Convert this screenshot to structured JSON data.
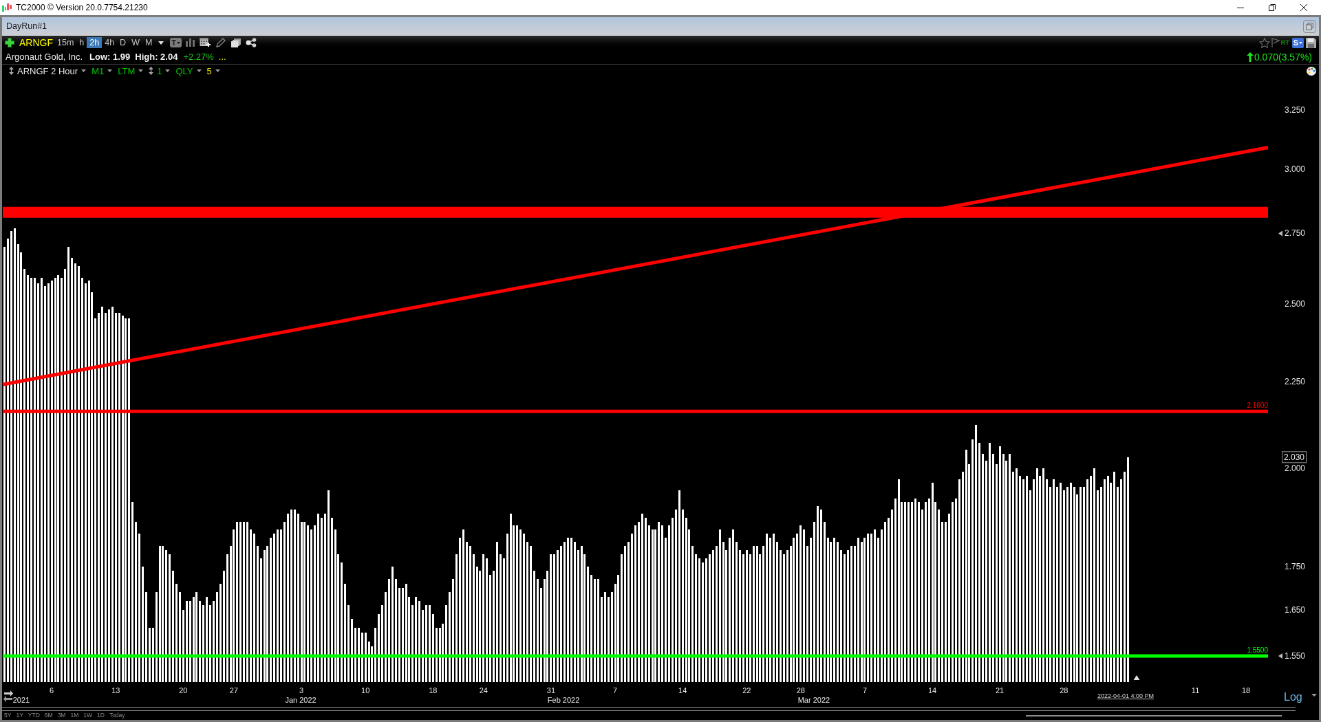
{
  "window": {
    "title": "TC2000 © Version 20.0.7754.21230"
  },
  "layout_tab": {
    "title": "DayRun#1"
  },
  "toolbar": {
    "symbol": "ARNGF",
    "intervals": [
      {
        "label": "15m",
        "selected": false
      },
      {
        "label": "h",
        "selected": false
      },
      {
        "label": "2h",
        "selected": true
      },
      {
        "label": "4h",
        "selected": false
      },
      {
        "label": "D",
        "selected": false
      },
      {
        "label": "W",
        "selected": false
      },
      {
        "label": "M",
        "selected": false
      }
    ],
    "text_button": "T",
    "rt_label": "RT",
    "s_button": "S"
  },
  "quote": {
    "company": "Argonaut Gold, Inc.",
    "low": "Low: 1.99",
    "high": "High: 2.04",
    "change_percent": "+2.27%",
    "more": "...",
    "net_change": "0.070(3.57%)"
  },
  "chart_settings": [
    {
      "kind": "stepper",
      "text": "ARNGF 2 Hour",
      "color": "#e8e8e8"
    },
    {
      "kind": "dropdown",
      "text": "M1",
      "color": "#00c800"
    },
    {
      "kind": "dropdown",
      "text": "LTM",
      "color": "#00c800"
    },
    {
      "kind": "stepper",
      "text": "1",
      "color": "#00c800"
    },
    {
      "kind": "dropdown",
      "text": "QLY",
      "color": "#00c800"
    },
    {
      "kind": "dropdown",
      "text": "5",
      "color": "#e6e600"
    }
  ],
  "chart": {
    "chart_data": {
      "type": "bar",
      "log": true,
      "categories": [
        null,
        null,
        null,
        null,
        null,
        null,
        null,
        null,
        null,
        null,
        null,
        null,
        null,
        null,
        "6",
        null,
        null,
        null,
        null,
        null,
        null,
        null,
        null,
        null,
        null,
        null,
        null,
        null,
        null,
        null,
        null,
        null,
        null,
        "13",
        null,
        null,
        null,
        null,
        null,
        null,
        null,
        null,
        null,
        null,
        null,
        null,
        null,
        null,
        null,
        null,
        null,
        null,
        null,
        "20",
        null,
        null,
        null,
        null,
        null,
        null,
        null,
        null,
        null,
        null,
        null,
        null,
        null,
        null,
        "27",
        null,
        null,
        null,
        null,
        null,
        null,
        null,
        null,
        null,
        null,
        null,
        null,
        null,
        null,
        null,
        null,
        null,
        null,
        null,
        "3",
        null,
        null,
        null,
        null,
        null,
        null,
        null,
        null,
        null,
        null,
        null,
        null,
        null,
        null,
        null,
        null,
        null,
        null,
        "10",
        null,
        null,
        null,
        null,
        null,
        null,
        null,
        null,
        null,
        null,
        null,
        null,
        null,
        null,
        null,
        null,
        null,
        null,
        null,
        "18",
        null,
        null,
        null,
        null,
        null,
        null,
        null,
        null,
        null,
        null,
        null,
        null,
        null,
        null,
        "24",
        null,
        null,
        null,
        null,
        null,
        null,
        null,
        null,
        null,
        null,
        null,
        null,
        null,
        null,
        null,
        null,
        null,
        null,
        null,
        "31",
        null,
        null,
        null,
        null,
        null,
        null,
        null,
        null,
        null,
        null,
        null,
        null,
        null,
        null,
        null,
        null,
        null,
        null,
        "7",
        null,
        null,
        null,
        null,
        null,
        null,
        null,
        null,
        null,
        null,
        null,
        null,
        null,
        null,
        null,
        null,
        null,
        null,
        null,
        "14",
        null,
        null,
        null,
        null,
        null,
        null,
        null,
        null,
        null,
        null,
        null,
        null,
        null,
        null,
        null,
        null,
        null,
        null,
        "22",
        null,
        null,
        null,
        null,
        null,
        null,
        null,
        null,
        null,
        null,
        null,
        null,
        null,
        null,
        null,
        "28",
        null,
        null,
        null,
        null,
        null,
        null,
        null,
        null,
        null,
        null,
        null,
        null,
        null,
        null,
        null,
        null,
        null,
        null,
        "7",
        null,
        null,
        null,
        null,
        null,
        null,
        null,
        null,
        null,
        null,
        null,
        null,
        null,
        null,
        null,
        null,
        null,
        null,
        null,
        "14",
        null,
        null,
        null,
        null,
        null,
        null,
        null,
        null,
        null,
        null,
        null,
        null,
        null,
        null,
        null,
        null,
        null,
        null,
        null,
        "21",
        null,
        null,
        null,
        null,
        null,
        null,
        null,
        null,
        null,
        null,
        null,
        null,
        null,
        null,
        null,
        null,
        null,
        null,
        "28",
        null,
        null,
        null,
        null,
        null,
        null,
        null,
        null,
        null,
        null,
        null,
        null,
        null,
        null,
        null,
        null,
        null,
        null,
        null,
        null,
        null,
        null,
        null,
        null,
        null,
        null,
        null,
        null,
        null,
        null,
        null,
        null,
        null,
        null,
        null,
        null,
        null,
        null,
        "11",
        null,
        null,
        null,
        null,
        null,
        null,
        null,
        null,
        null,
        null,
        null,
        null,
        null,
        null,
        "18",
        null,
        null,
        null,
        null,
        null,
        null
      ],
      "values": [
        2.7,
        2.73,
        2.76,
        2.77,
        2.71,
        2.68,
        2.62,
        2.6,
        2.59,
        2.59,
        2.57,
        2.59,
        2.56,
        2.57,
        2.58,
        2.59,
        2.6,
        2.59,
        2.62,
        2.7,
        2.66,
        2.64,
        2.63,
        2.59,
        2.57,
        2.58,
        2.54,
        2.45,
        2.47,
        2.49,
        2.47,
        2.48,
        2.49,
        2.47,
        2.47,
        2.46,
        2.45,
        2.45,
        1.91,
        1.86,
        1.83,
        1.75,
        1.69,
        1.61,
        1.61,
        1.69,
        1.8,
        1.8,
        1.79,
        1.78,
        1.74,
        1.71,
        1.69,
        1.65,
        1.67,
        1.67,
        1.68,
        1.69,
        1.67,
        1.66,
        1.68,
        1.66,
        1.67,
        1.69,
        1.71,
        1.74,
        1.78,
        1.8,
        1.84,
        1.86,
        1.86,
        1.86,
        1.86,
        1.84,
        1.83,
        1.8,
        1.77,
        1.79,
        1.8,
        1.82,
        1.83,
        1.84,
        1.84,
        1.86,
        1.88,
        1.89,
        1.89,
        1.88,
        1.86,
        1.86,
        1.85,
        1.84,
        1.85,
        1.88,
        1.87,
        1.88,
        1.94,
        1.87,
        1.84,
        1.78,
        1.76,
        1.71,
        1.66,
        1.63,
        1.61,
        1.61,
        1.6,
        1.6,
        1.58,
        1.57,
        1.61,
        1.64,
        1.66,
        1.69,
        1.72,
        1.75,
        1.72,
        1.7,
        1.7,
        1.71,
        1.68,
        1.66,
        1.68,
        1.67,
        1.65,
        1.66,
        1.66,
        1.64,
        1.61,
        1.61,
        1.62,
        1.66,
        1.69,
        1.72,
        1.78,
        1.82,
        1.84,
        1.81,
        1.8,
        1.78,
        1.75,
        1.74,
        1.78,
        1.77,
        1.73,
        1.74,
        1.81,
        1.78,
        1.77,
        1.83,
        1.88,
        1.85,
        1.85,
        1.84,
        1.83,
        1.81,
        1.8,
        1.74,
        1.72,
        1.7,
        1.72,
        1.74,
        1.78,
        1.78,
        1.79,
        1.8,
        1.81,
        1.82,
        1.82,
        1.81,
        1.79,
        1.8,
        1.78,
        1.75,
        1.73,
        1.72,
        1.72,
        1.68,
        1.69,
        1.68,
        1.69,
        1.71,
        1.73,
        1.78,
        1.8,
        1.81,
        1.83,
        1.85,
        1.86,
        1.88,
        1.87,
        1.85,
        1.84,
        1.84,
        1.86,
        1.85,
        1.82,
        1.85,
        1.87,
        1.89,
        1.94,
        1.89,
        1.87,
        1.84,
        1.8,
        1.78,
        1.77,
        1.76,
        1.77,
        1.78,
        1.79,
        1.8,
        1.84,
        1.81,
        1.79,
        1.82,
        1.84,
        1.81,
        1.79,
        1.78,
        1.79,
        1.78,
        1.8,
        1.8,
        1.78,
        1.8,
        1.83,
        1.82,
        1.83,
        1.81,
        1.79,
        1.78,
        1.79,
        1.8,
        1.82,
        1.83,
        1.85,
        1.84,
        1.8,
        1.82,
        1.86,
        1.9,
        1.89,
        1.86,
        1.82,
        1.81,
        1.82,
        1.81,
        1.79,
        1.78,
        1.79,
        1.8,
        1.8,
        1.82,
        1.81,
        1.82,
        1.83,
        1.83,
        1.84,
        1.82,
        1.84,
        1.86,
        1.87,
        1.89,
        1.92,
        1.97,
        1.91,
        1.91,
        1.91,
        1.91,
        1.92,
        1.91,
        1.89,
        1.91,
        1.92,
        1.96,
        1.91,
        1.89,
        1.86,
        1.86,
        1.88,
        1.91,
        1.92,
        1.97,
        1.99,
        2.05,
        2.01,
        2.08,
        2.12,
        2.07,
        2.04,
        2.02,
        2.07,
        2.04,
        2.01,
        2.06,
        2.04,
        2.02,
        2.04,
        1.99,
        2.0,
        1.98,
        1.97,
        1.98,
        1.94,
        1.97,
        2.0,
        1.98,
        2.0,
        1.97,
        1.95,
        1.97,
        1.95,
        1.96,
        1.94,
        1.95,
        1.96,
        1.95,
        1.93,
        1.95,
        1.95,
        1.97,
        1.98,
        2.0,
        1.94,
        1.95,
        1.97,
        1.98,
        1.96,
        1.99,
        1.95,
        1.97,
        1.99,
        2.03,
        null,
        null,
        null,
        null,
        null,
        null,
        null,
        null,
        null,
        null,
        null,
        null,
        null,
        null,
        null,
        null,
        null,
        null,
        null,
        null,
        null,
        null,
        null,
        null,
        null,
        null,
        null,
        null,
        null,
        null,
        null,
        null,
        null,
        null,
        null,
        null,
        null,
        null,
        null,
        null,
        null
      ],
      "ylim": [
        1.496,
        3.4
      ],
      "yticks": [
        {
          "value": 3.25,
          "label": "3.250"
        },
        {
          "value": 3.0,
          "label": "3.000"
        },
        {
          "value": 2.75,
          "label": "2.750"
        },
        {
          "value": 2.5,
          "label": "2.500"
        },
        {
          "value": 2.25,
          "label": "2.250"
        },
        {
          "value": 2.0,
          "label": "2.000"
        },
        {
          "value": 1.75,
          "label": "1.750"
        },
        {
          "value": 1.65,
          "label": "1.650"
        },
        {
          "value": 1.55,
          "label": "1.550"
        }
      ],
      "ref_lines": [
        {
          "value": 2.83,
          "axis": "y",
          "color": "#ff0000"
        },
        {
          "value": 2.16,
          "axis": "y",
          "label": "2.1600",
          "color": "#ff0000"
        },
        {
          "value": 1.55,
          "axis": "y",
          "label": "1.5500",
          "color": "#00ff00"
        }
      ]
    },
    "period_labels": [
      "2021",
      "Jan 2022",
      "Feb 2022",
      "Mar 2022"
    ],
    "last_price_label": "2.030",
    "cursor_date": "2022-04-01 4:00 PM",
    "scale_button": "Log"
  },
  "range_buttons": [
    "5Y",
    "1Y",
    "YTD",
    "6M",
    "3M",
    "1M",
    "1W",
    "1D",
    "Today"
  ]
}
